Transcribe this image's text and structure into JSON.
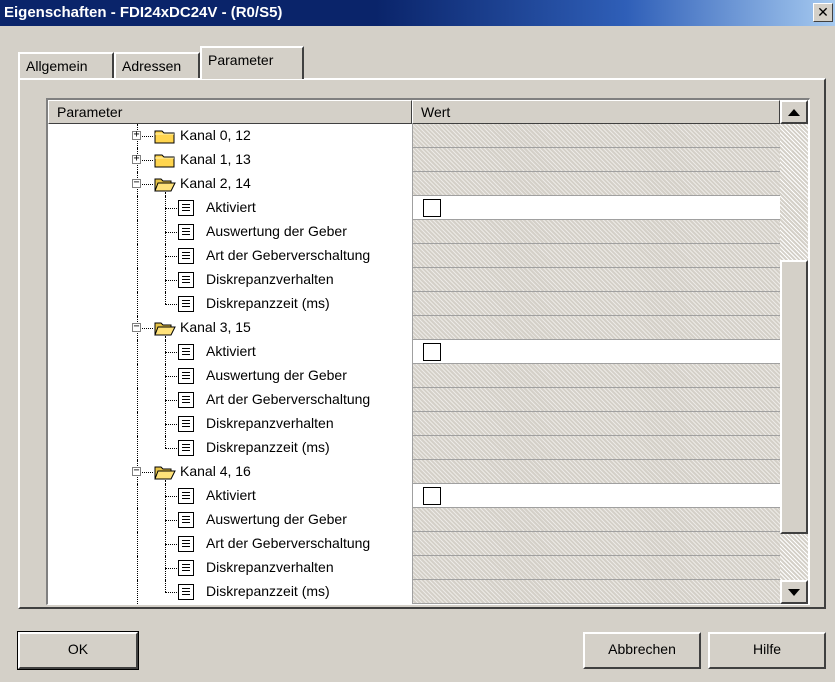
{
  "window": {
    "title": "Eigenschaften - FDI24xDC24V - (R0/S5)",
    "close_label": "✕"
  },
  "tabs": [
    {
      "label": "Allgemein",
      "active": false
    },
    {
      "label": "Adressen",
      "active": false
    },
    {
      "label": "Parameter",
      "active": true
    }
  ],
  "grid": {
    "columns": {
      "parameter": "Parameter",
      "value": "Wert"
    },
    "rows": [
      {
        "type": "folder",
        "expanded": false,
        "label": "Kanal 0, 12"
      },
      {
        "type": "folder",
        "expanded": false,
        "label": "Kanal 1, 13"
      },
      {
        "type": "folder",
        "expanded": true,
        "label": "Kanal 2, 14"
      },
      {
        "type": "param",
        "label": "Aktiviert",
        "checkbox": true
      },
      {
        "type": "param",
        "label": "Auswertung der Geber"
      },
      {
        "type": "param",
        "label": "Art der Geberverschaltung"
      },
      {
        "type": "param",
        "label": "Diskrepanzverhalten"
      },
      {
        "type": "param",
        "label": "Diskrepanzzeit (ms)"
      },
      {
        "type": "folder",
        "expanded": true,
        "label": "Kanal 3, 15"
      },
      {
        "type": "param",
        "label": "Aktiviert",
        "checkbox": true
      },
      {
        "type": "param",
        "label": "Auswertung der Geber"
      },
      {
        "type": "param",
        "label": "Art der Geberverschaltung"
      },
      {
        "type": "param",
        "label": "Diskrepanzverhalten"
      },
      {
        "type": "param",
        "label": "Diskrepanzzeit (ms)"
      },
      {
        "type": "folder",
        "expanded": true,
        "label": "Kanal 4, 16"
      },
      {
        "type": "param",
        "label": "Aktiviert",
        "checkbox": true
      },
      {
        "type": "param",
        "label": "Auswertung der Geber"
      },
      {
        "type": "param",
        "label": "Art der Geberverschaltung"
      },
      {
        "type": "param",
        "label": "Diskrepanzverhalten"
      },
      {
        "type": "param",
        "label": "Diskrepanzzeit (ms)"
      }
    ]
  },
  "icons": {
    "folder": "folder-icon",
    "parameter": "parameter-icon",
    "expand": "expand-icon",
    "collapse": "collapse-icon"
  },
  "colors": {
    "title_bar": "#0a246a",
    "dialog_bg": "#d4d0c8",
    "folder": "#ffd54f"
  },
  "buttons": {
    "ok": "OK",
    "cancel": "Abbrechen",
    "help": "Hilfe"
  }
}
